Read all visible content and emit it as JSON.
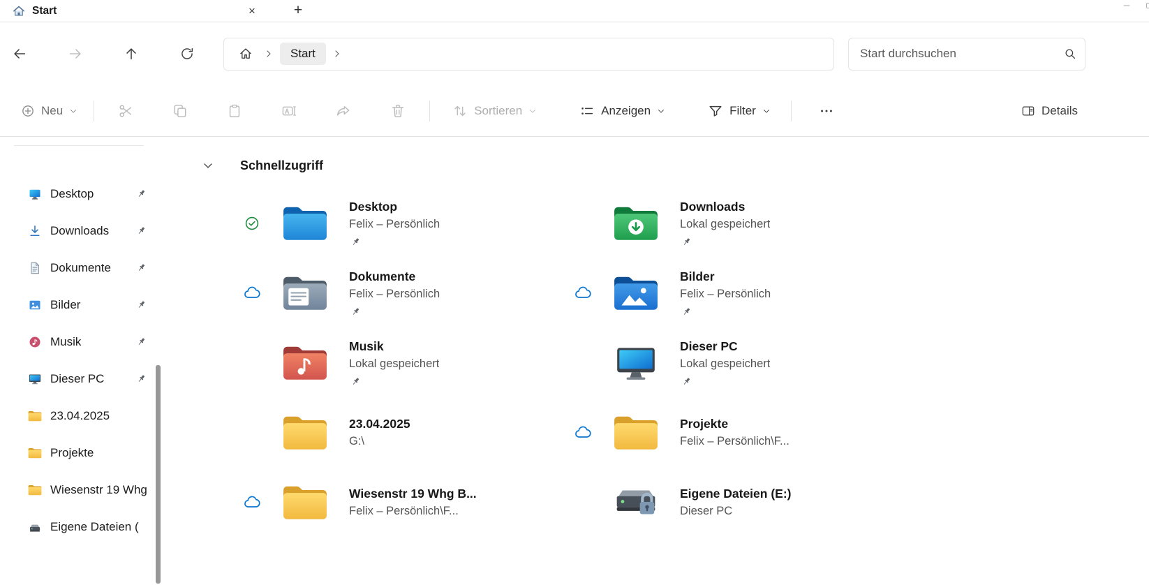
{
  "colors": {
    "accent_blue": "#0b76d1",
    "check_green": "#1e8a3d",
    "folder_yellow": "#ffd264",
    "breadcrumb_pill_gray": "#ededed"
  },
  "icons": {
    "tab_favicon": "home-icon",
    "status_synced": "check-circle-icon",
    "status_cloud": "cloud-icon",
    "pinned_marker": "pin-icon",
    "search": "search-icon"
  },
  "tabbar": {
    "tab_title": "Start",
    "close_glyph": "×",
    "new_tab_glyph": "+"
  },
  "navbar": {
    "breadcrumb_current": "Start",
    "search_placeholder": "Start durchsuchen"
  },
  "toolbar": {
    "neu": "Neu",
    "sortieren": "Sortieren",
    "anzeigen": "Anzeigen",
    "filter": "Filter",
    "details": "Details"
  },
  "sidebar": {
    "items": [
      {
        "label": "Desktop",
        "icon": "desktop-icon",
        "pinned": true
      },
      {
        "label": "Downloads",
        "icon": "downloads-icon",
        "pinned": true
      },
      {
        "label": "Dokumente",
        "icon": "document-icon",
        "pinned": true
      },
      {
        "label": "Bilder",
        "icon": "pictures-icon",
        "pinned": true
      },
      {
        "label": "Musik",
        "icon": "music-icon",
        "pinned": true
      },
      {
        "label": "Dieser PC",
        "icon": "this-pc-icon",
        "pinned": true
      },
      {
        "label": "23.04.2025",
        "icon": "folder-icon",
        "pinned": false
      },
      {
        "label": "Projekte",
        "icon": "folder-icon",
        "pinned": false
      },
      {
        "label": "Wiesenstr 19 Whg",
        "icon": "folder-icon",
        "pinned": false
      },
      {
        "label": "Eigene Dateien (",
        "icon": "drive-icon",
        "pinned": false
      }
    ]
  },
  "main": {
    "section_title": "Schnellzugriff",
    "items": [
      {
        "name": "Desktop",
        "subtitle": "Felix – Persönlich",
        "icon": "folder-desktop-icon",
        "status": "synced",
        "pinned": true
      },
      {
        "name": "Downloads",
        "subtitle": "Lokal gespeichert",
        "icon": "folder-downloads-icon",
        "status": "none",
        "pinned": true
      },
      {
        "name": "Dokumente",
        "subtitle": "Felix – Persönlich",
        "icon": "folder-documents-icon",
        "status": "cloud",
        "pinned": true
      },
      {
        "name": "Bilder",
        "subtitle": "Felix – Persönlich",
        "icon": "folder-pictures-icon",
        "status": "cloud",
        "pinned": true
      },
      {
        "name": "Musik",
        "subtitle": "Lokal gespeichert",
        "icon": "folder-music-icon",
        "status": "none",
        "pinned": true
      },
      {
        "name": "Dieser PC",
        "subtitle": "Lokal gespeichert",
        "icon": "this-pc-icon",
        "status": "none",
        "pinned": true
      },
      {
        "name": "23.04.2025",
        "subtitle": "G:\\",
        "icon": "folder-icon",
        "status": "none",
        "pinned": false
      },
      {
        "name": "Projekte",
        "subtitle": "Felix – Persönlich\\F...",
        "icon": "folder-icon",
        "status": "cloud",
        "pinned": false
      },
      {
        "name": "Wiesenstr 19 Whg B...",
        "subtitle": "Felix – Persönlich\\F...",
        "icon": "folder-icon",
        "status": "cloud",
        "pinned": false
      },
      {
        "name": "Eigene Dateien (E:)",
        "subtitle": "Dieser PC",
        "icon": "drive-lock-icon",
        "status": "none",
        "pinned": false
      }
    ]
  }
}
